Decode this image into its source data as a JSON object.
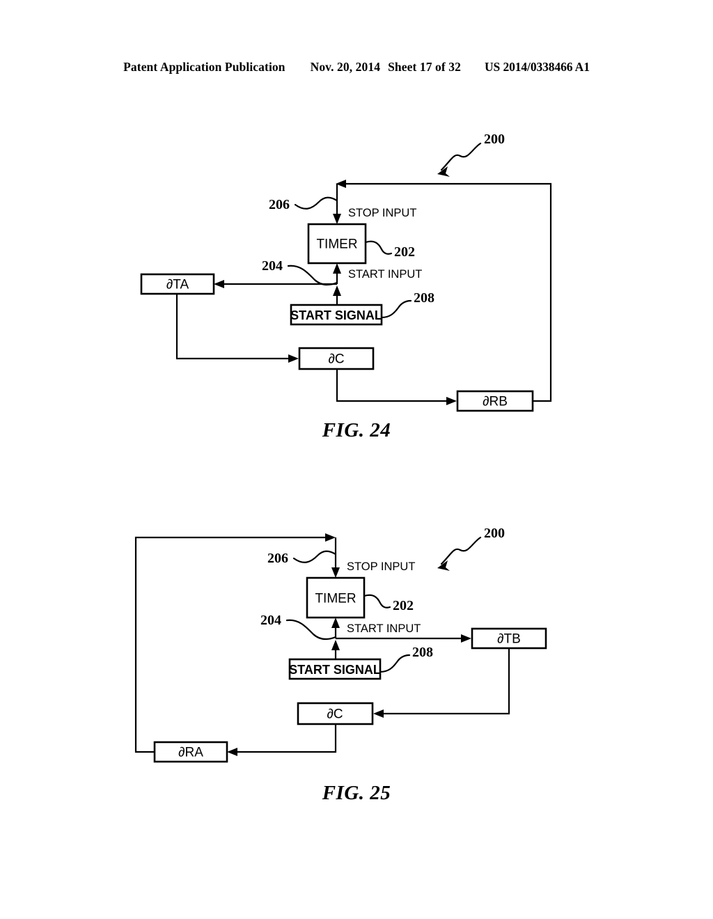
{
  "header": {
    "publication": "Patent Application Publication",
    "date": "Nov. 20, 2014",
    "sheet": "Sheet 17 of 32",
    "patent_number": "US 2014/0338466 A1"
  },
  "figures": [
    {
      "id": "fig-24",
      "caption": "FIG. 24",
      "system_ref": "200",
      "boxes": {
        "timer": "TIMER",
        "start_signal": "START SIGNAL",
        "delta_ta": "∂TA",
        "delta_c": "∂C",
        "delta_rb": "∂RB"
      },
      "ports": {
        "stop_input": "STOP INPUT",
        "start_input": "START INPUT"
      },
      "refs": {
        "timer": "202",
        "start_input": "204",
        "stop_input": "206",
        "start_signal": "208"
      }
    },
    {
      "id": "fig-25",
      "caption": "FIG. 25",
      "system_ref": "200",
      "boxes": {
        "timer": "TIMER",
        "start_signal": "START SIGNAL",
        "delta_tb": "∂TB",
        "delta_c": "∂C",
        "delta_ra": "∂RA"
      },
      "ports": {
        "stop_input": "STOP INPUT",
        "start_input": "START INPUT"
      },
      "refs": {
        "timer": "202",
        "start_input": "204",
        "stop_input": "206",
        "start_signal": "208"
      }
    }
  ]
}
